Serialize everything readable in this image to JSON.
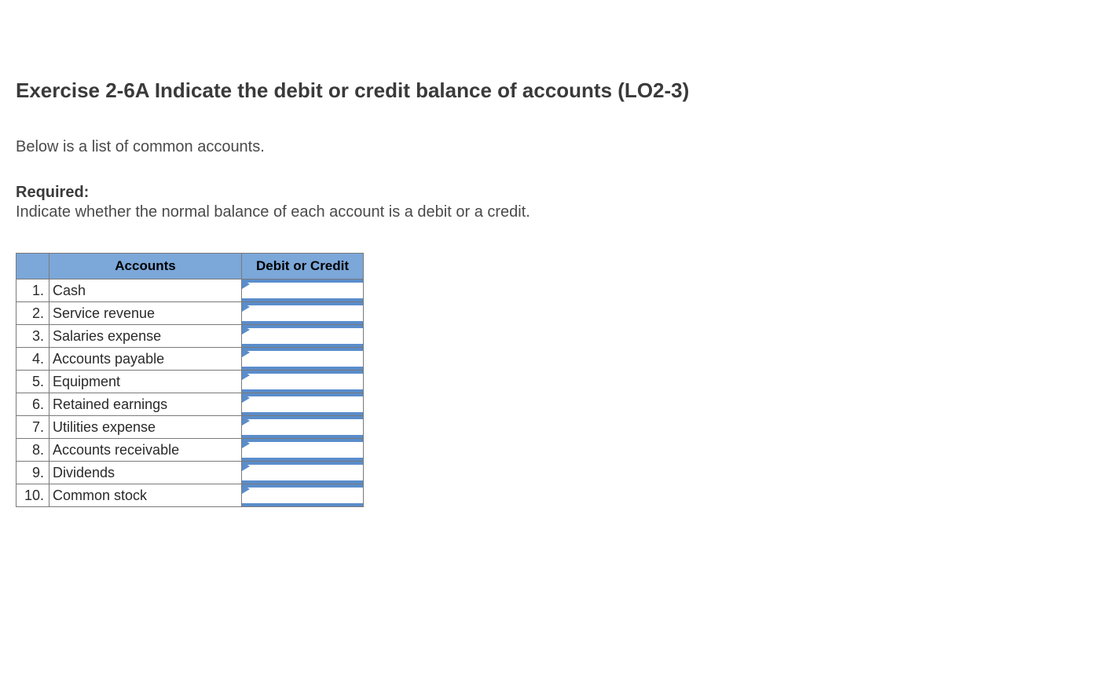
{
  "title": "Exercise 2-6A Indicate the debit or credit balance of accounts (LO2-3)",
  "intro": "Below is a list of common accounts.",
  "required_label": "Required:",
  "required_text": "Indicate whether the normal balance of each account is a debit or a credit.",
  "table": {
    "headers": {
      "num": "",
      "accounts": "Accounts",
      "debit_credit": "Debit or Credit"
    },
    "rows": [
      {
        "num": "1.",
        "account": "Cash",
        "debit_credit": ""
      },
      {
        "num": "2.",
        "account": "Service revenue",
        "debit_credit": ""
      },
      {
        "num": "3.",
        "account": "Salaries expense",
        "debit_credit": ""
      },
      {
        "num": "4.",
        "account": "Accounts payable",
        "debit_credit": ""
      },
      {
        "num": "5.",
        "account": "Equipment",
        "debit_credit": ""
      },
      {
        "num": "6.",
        "account": "Retained earnings",
        "debit_credit": ""
      },
      {
        "num": "7.",
        "account": "Utilities expense",
        "debit_credit": ""
      },
      {
        "num": "8.",
        "account": "Accounts receivable",
        "debit_credit": ""
      },
      {
        "num": "9.",
        "account": "Dividends",
        "debit_credit": ""
      },
      {
        "num": "10.",
        "account": "Common stock",
        "debit_credit": ""
      }
    ]
  }
}
